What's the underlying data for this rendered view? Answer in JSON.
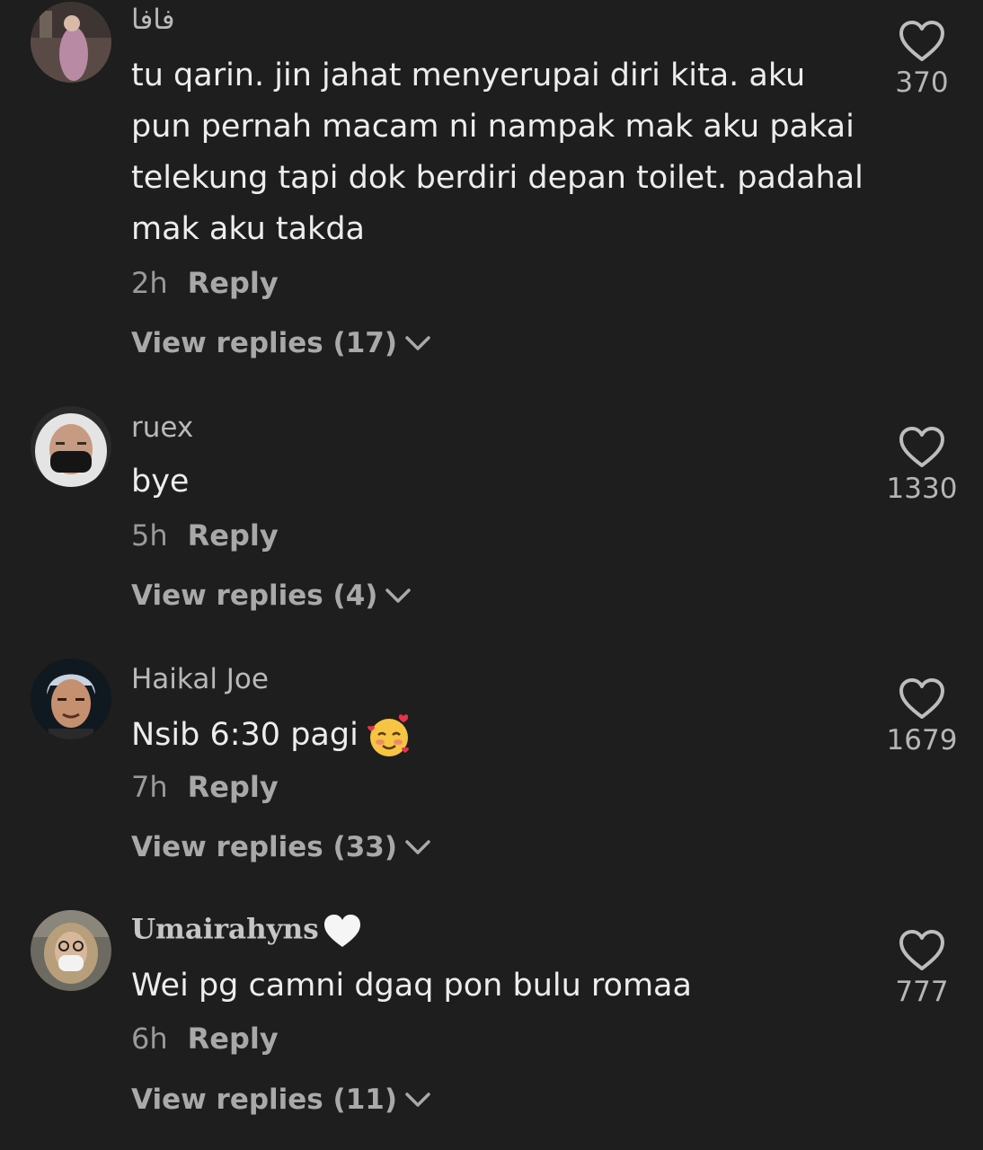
{
  "comments": [
    {
      "username": "فافا",
      "text": "tu qarin. jin jahat menyerupai diri kita. aku pun pernah macam ni nampak mak aku pakai telekung tapi dok berdiri depan toilet. padahal mak aku takda",
      "time": "2h",
      "reply_label": "Reply",
      "view_replies": "View replies (17)",
      "likes": "370"
    },
    {
      "username": "ruex",
      "text": "bye",
      "time": "5h",
      "reply_label": "Reply",
      "view_replies": "View replies (4)",
      "likes": "1330"
    },
    {
      "username": "Haikal Joe",
      "text": "Nsib 6:30 pagi",
      "emoji": "smiling-face-with-hearts",
      "time": "7h",
      "reply_label": "Reply",
      "view_replies": "View replies (33)",
      "likes": "1679"
    },
    {
      "username": "Umairahyns",
      "username_emoji": "white-heart",
      "text": "Wei pg camni dgaq pon bulu romaa",
      "time": "6h",
      "reply_label": "Reply",
      "view_replies": "View replies (11)",
      "likes": "777"
    }
  ],
  "colors": {
    "background": "#1e1e1e",
    "text": "#ededed",
    "muted": "#a9a9a9"
  },
  "icons": [
    "heart-outline-icon",
    "chevron-down-icon"
  ]
}
